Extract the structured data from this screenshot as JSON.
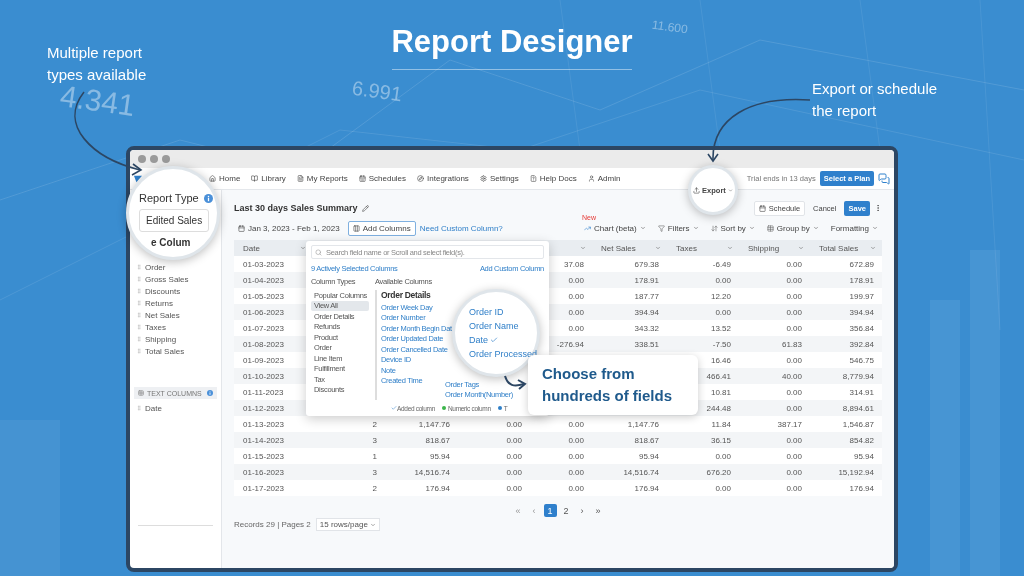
{
  "page": {
    "title": "Report Designer",
    "annotations": [
      "Multiple report types available",
      "Export or schedule the report"
    ],
    "background_numbers": [
      "4.341",
      "6.991",
      "11.600"
    ]
  },
  "nav": {
    "items": [
      "Home",
      "Library",
      "My Reports",
      "Schedules",
      "Integrations",
      "Settings",
      "Help Docs",
      "Admin"
    ],
    "trial": "Trial ends in 13 days",
    "plan_button": "Select a Plan"
  },
  "sidebar": {
    "items": [
      "Order",
      "Gross Sales",
      "Discounts",
      "Returns",
      "Net Sales",
      "Taxes",
      "Shipping",
      "Total Sales"
    ],
    "text_section": "TEXT COLUMNS",
    "text_items": [
      "Date"
    ]
  },
  "report_type_lens": {
    "label": "Report Type",
    "value": "Edited Sales",
    "cut_heading": "e Colum"
  },
  "header": {
    "title": "Last 30 days Sales Summary",
    "export": "Export",
    "buttons": [
      "Schedule",
      "Cancel",
      "Save"
    ]
  },
  "toolbar": {
    "date_range": "Jan 3, 2023 - Feb 1, 2023",
    "add_columns": "Add Columns",
    "custom_link": "Need Custom Column?",
    "new_badge": "New",
    "tools": [
      "Chart (beta)",
      "Filters",
      "Sort by",
      "Group by",
      "Formatting"
    ]
  },
  "table": {
    "columns": [
      {
        "label": "Date",
        "sortable": true
      },
      null,
      null,
      null,
      {
        "sortable": true
      },
      {
        "label": "Net Sales",
        "sortable": true
      },
      {
        "label": "Taxes",
        "sortable": true
      },
      {
        "label": "Shipping",
        "sortable": true
      },
      {
        "label": "Total Sales",
        "sortable": true
      }
    ],
    "rows": [
      {
        "cells": [
          "01-03-2023",
          null,
          null,
          null,
          "37.08",
          "679.38",
          "-6.49",
          "0.00",
          "672.89"
        ]
      },
      {
        "cells": [
          "01-04-2023",
          null,
          null,
          null,
          "0.00",
          "178.91",
          "0.00",
          "0.00",
          "178.91"
        ]
      },
      {
        "cells": [
          "01-05-2023",
          null,
          null,
          null,
          "0.00",
          "187.77",
          "12.20",
          "0.00",
          "199.97"
        ]
      },
      {
        "cells": [
          "01-06-2023",
          null,
          null,
          null,
          "0.00",
          "394.94",
          "0.00",
          "0.00",
          "394.94"
        ]
      },
      {
        "cells": [
          "01-07-2023",
          null,
          null,
          null,
          "0.00",
          "343.32",
          "13.52",
          "0.00",
          "356.84"
        ]
      },
      {
        "cells": [
          "01-08-2023",
          null,
          null,
          null,
          "-276.94",
          "338.51",
          "-7.50",
          "61.83",
          "392.84"
        ]
      },
      {
        "cells": [
          "01-09-2023",
          null,
          null,
          null,
          null,
          null,
          "16.46",
          "0.00",
          "546.75"
        ]
      },
      {
        "cells": [
          "01-10-2023",
          null,
          null,
          null,
          null,
          null,
          "466.41",
          "40.00",
          "8,779.94"
        ]
      },
      {
        "cells": [
          "01-11-2023",
          null,
          null,
          null,
          null,
          null,
          "10.81",
          "0.00",
          "314.91"
        ]
      },
      {
        "cells": [
          "01-12-2023",
          null,
          null,
          null,
          null,
          null,
          "244.48",
          "0.00",
          "8,894.61"
        ]
      },
      {
        "cells": [
          "01-13-2023",
          "2",
          "1,147.76",
          "0.00",
          "0.00",
          "1,147.76",
          "11.84",
          "387.17",
          "1,546.87"
        ]
      },
      {
        "cells": [
          "01-14-2023",
          "3",
          "818.67",
          "0.00",
          "0.00",
          "818.67",
          "36.15",
          "0.00",
          "854.82"
        ]
      },
      {
        "cells": [
          "01-15-2023",
          "1",
          "95.94",
          "0.00",
          "0.00",
          "95.94",
          "0.00",
          "0.00",
          "95.94"
        ]
      },
      {
        "cells": [
          "01-16-2023",
          "3",
          "14,516.74",
          "0.00",
          "0.00",
          "14,516.74",
          "676.20",
          "0.00",
          "15,192.94"
        ]
      },
      {
        "cells": [
          "01-17-2023",
          "2",
          "176.94",
          "0.00",
          "0.00",
          "176.94",
          "0.00",
          "0.00",
          "176.94"
        ]
      }
    ]
  },
  "pagination": {
    "items": [
      {
        "label": "«",
        "selected": false,
        "disabled": true
      },
      {
        "label": "‹",
        "selected": false,
        "disabled": true
      },
      {
        "label": "1",
        "selected": true,
        "disabled": false
      },
      {
        "label": "2",
        "selected": false,
        "disabled": false
      },
      {
        "label": "›",
        "selected": false,
        "disabled": false
      },
      {
        "label": "»",
        "selected": false,
        "disabled": false
      }
    ],
    "records": "Records 29 | Pages 2",
    "page_size": "15 rows/page"
  },
  "column_picker": {
    "placeholder": "Search field name or Scroll and select field(s).",
    "selected_count": "9 Actively Selected Columns",
    "add_custom": "Add Custom Column",
    "types_heading": "Column Types",
    "available_heading": "Available Columns",
    "types": [
      {
        "label": "Popular Columns",
        "selected": false
      },
      {
        "label": "View All",
        "selected": true
      },
      {
        "label": "Order Details",
        "selected": false
      },
      {
        "label": "Refunds",
        "selected": false
      },
      {
        "label": "Product",
        "selected": false
      },
      {
        "label": "Order",
        "selected": false
      },
      {
        "label": "Line Item",
        "selected": false
      },
      {
        "label": "Fulfillment",
        "selected": false
      },
      {
        "label": "Tax",
        "selected": false
      },
      {
        "label": "Discounts",
        "selected": false
      }
    ],
    "group": "Order Details",
    "fields": [
      "Order Week Day",
      "Order Number",
      "Order Month Begin Dat",
      "Order Updated Date",
      "Order Cancelled Date",
      "Device ID",
      "Note",
      "Created Time"
    ],
    "fields_right": [
      "Order Tags",
      "Order Month(Number)"
    ],
    "legend": [
      {
        "label": "Added column",
        "kind": "check"
      },
      {
        "label": "Numeric column",
        "kind": "dot",
        "color": "#3cb54a"
      },
      {
        "label": "T",
        "kind": "dot",
        "color": "#2f7fc8"
      }
    ]
  },
  "fields_lens": {
    "items": [
      {
        "label": "Order ID",
        "checked": false
      },
      {
        "label": "Order Name",
        "checked": false
      },
      {
        "label": "Date",
        "checked": true
      },
      {
        "label": "Order Processed",
        "checked": false
      }
    ]
  },
  "callout": {
    "lines": [
      "Choose from",
      "hundreds of fields"
    ]
  }
}
